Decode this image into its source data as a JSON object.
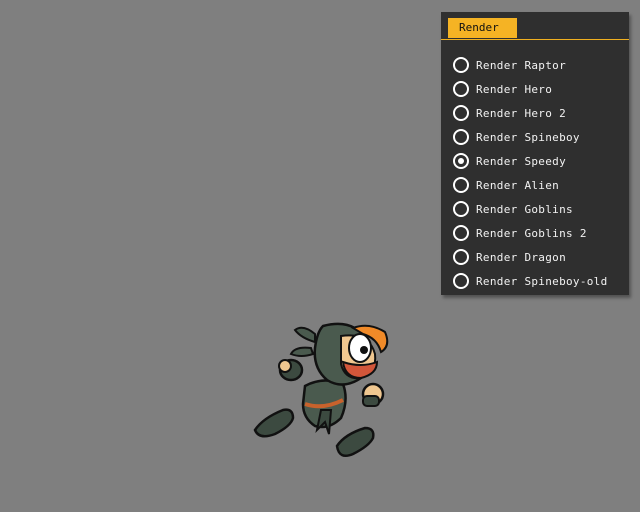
{
  "panel": {
    "title": "Render",
    "options": [
      {
        "label": "Render Raptor",
        "checked": false
      },
      {
        "label": "Render Hero",
        "checked": false
      },
      {
        "label": "Render Hero 2",
        "checked": false
      },
      {
        "label": "Render Spineboy",
        "checked": false
      },
      {
        "label": "Render Speedy",
        "checked": true
      },
      {
        "label": "Render Alien",
        "checked": false
      },
      {
        "label": "Render Goblins",
        "checked": false
      },
      {
        "label": "Render Goblins 2",
        "checked": false
      },
      {
        "label": "Render Dragon",
        "checked": false
      },
      {
        "label": "Render Spineboy-old",
        "checked": false
      }
    ]
  },
  "colors": {
    "background": "#7f7f7f",
    "panel": "#2f2f2f",
    "accent": "#f5b324"
  }
}
